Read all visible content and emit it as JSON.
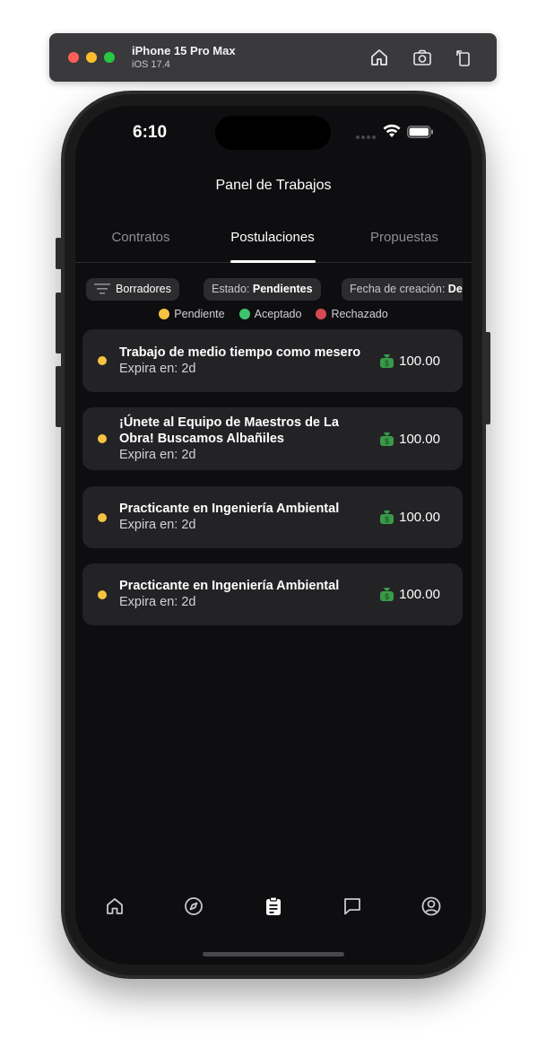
{
  "simulator": {
    "device_name": "iPhone 15 Pro Max",
    "os_version": "iOS 17.4",
    "buttons": [
      "home-icon",
      "screenshot-icon",
      "rotate-icon"
    ]
  },
  "status_bar": {
    "time": "6:10"
  },
  "header": {
    "title": "Panel de Trabajos"
  },
  "tabs": [
    {
      "label": "Contratos",
      "active": false
    },
    {
      "label": "Postulaciones",
      "active": true
    },
    {
      "label": "Propuestas",
      "active": false
    }
  ],
  "filters": {
    "drafts_label": "Borradores",
    "status_prefix": "Estado:",
    "status_value": "Pendientes",
    "date_prefix": "Fecha de creación:",
    "date_value": "De"
  },
  "legend": [
    {
      "label": "Pendiente",
      "color": "#f5c242"
    },
    {
      "label": "Aceptado",
      "color": "#3ec46d"
    },
    {
      "label": "Rechazado",
      "color": "#d64a55"
    }
  ],
  "jobs": [
    {
      "title": "Trabajo de medio tiempo como mesero",
      "expires": "Expira en: 2d",
      "amount": "100.00",
      "status_color": "#f5c242"
    },
    {
      "title": "¡Únete al Equipo de Maestros de La Obra! Buscamos Albañiles",
      "expires": "Expira en: 2d",
      "amount": "100.00",
      "status_color": "#f5c242"
    },
    {
      "title": "Practicante en Ingeniería Ambiental",
      "expires": "Expira en: 2d",
      "amount": "100.00",
      "status_color": "#f5c242"
    },
    {
      "title": "Practicante en Ingeniería Ambiental",
      "expires": "Expira en: 2d",
      "amount": "100.00",
      "status_color": "#f5c242"
    }
  ],
  "bottom_nav": [
    {
      "icon": "home-icon",
      "active": false
    },
    {
      "icon": "compass-icon",
      "active": false
    },
    {
      "icon": "clipboard-icon",
      "active": true
    },
    {
      "icon": "chat-icon",
      "active": false
    },
    {
      "icon": "profile-icon",
      "active": false
    }
  ],
  "colors": {
    "background": "#0e0e10",
    "card": "#232326",
    "money_icon": "#3a9a4a"
  }
}
